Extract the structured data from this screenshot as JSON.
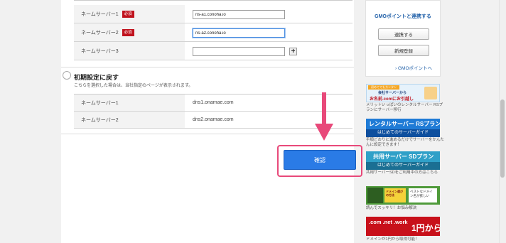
{
  "nameservers": {
    "rows": [
      {
        "label": "ネームサーバー1",
        "required": "必須",
        "value": "ns-a1.conoha.io"
      },
      {
        "label": "ネームサーバー2",
        "required": "必須",
        "value": "ns-a2.conoha.io"
      },
      {
        "label": "ネームサーバー3",
        "required": "",
        "value": ""
      }
    ],
    "add_symbol": "+"
  },
  "reset": {
    "title": "初期設定に戻す",
    "description": "こちらを選択した場合は、当社指定のページが表示されます。",
    "rows": [
      {
        "label": "ネームサーバー1",
        "value": "dns1.onamae.com"
      },
      {
        "label": "ネームサーバー2",
        "value": "dns2.onamae.com"
      }
    ]
  },
  "confirm_button": "確認",
  "sidebar": {
    "gmo_title": "GMOポイントと連携する",
    "link_button": "連携する",
    "register_button": "新規登録",
    "gmo_link": "GMOポイントへ",
    "banners": [
      {
        "line1": "初めてでもカンタン",
        "line2": "会社サーバーから",
        "line3": "お名前.comにお引越し",
        "caption": "メリットいっぱいのレンタルサーバー RSプランにサーバー移行"
      },
      {
        "line1": "レンタルサーバー RSプラン",
        "line2": "はじめてのサーバーガイド",
        "caption": "手順どおりに進めるだけでサーバーをかんたんに設定できます！"
      },
      {
        "line1": "共用サーバー SDプラン",
        "line2": "はじめてのサーバーガイド",
        "caption": "共用サーバーSDをご利用中の方はこちら"
      },
      {
        "line1": "ドメイン選びの方法",
        "line2": "ベストなドメイン名が欲しい",
        "caption": "読んでスッキリ！お悩み解決"
      },
      {
        "line1": ".com .net .work",
        "line2": "1円から",
        "caption": "ドメインが1円から取得可能！"
      }
    ]
  },
  "colors": {
    "accent": "#2a7be6",
    "highlight": "#e8497a",
    "required": "#c0121d",
    "link": "#1f5fa8"
  }
}
